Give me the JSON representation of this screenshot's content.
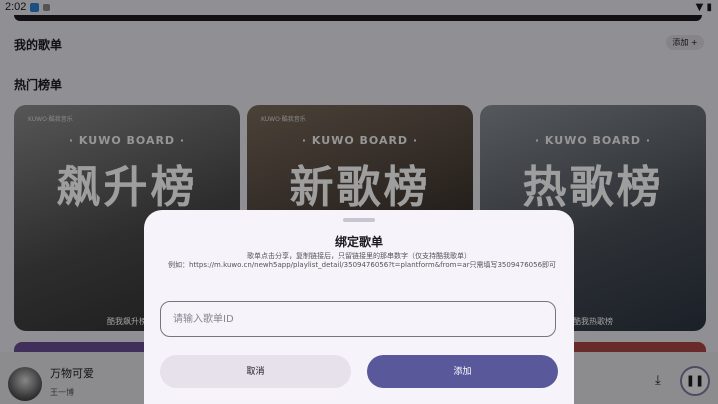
{
  "status_bar": {
    "time": "2:02",
    "icons": [
      "notification-icon",
      "media-icon",
      "wifi-icon",
      "battery-icon"
    ]
  },
  "sections": {
    "my_playlists": "我的歌单",
    "add_label": "添加 +",
    "hot_charts": "热门榜单"
  },
  "charts": [
    {
      "brand": "KUWO·酷我音乐",
      "board": "· KUWO BOARD ·",
      "title": "飙升榜",
      "caption": "酷我飙升榜"
    },
    {
      "brand": "KUWO·酷我音乐",
      "board": "· KUWO BOARD ·",
      "title": "新歌榜",
      "caption": ""
    },
    {
      "brand": "",
      "board": "· KUWO BOARD ·",
      "title": "热歌榜",
      "caption": "酷我热歌榜"
    }
  ],
  "player": {
    "title": "万物可爱",
    "artist": "王一博"
  },
  "dialog": {
    "title": "绑定歌单",
    "description": "歌单点击分享，复制链接后，只留链接里的那串数字（仅支持酷我歌单）",
    "example": "例如：https://m.kuwo.cn/newh5app/playlist_detail/3509476056?t=plantform&from=ar只需填写3509476056即可",
    "input_placeholder": "请输入歌单ID",
    "input_value": "",
    "cancel_label": "取消",
    "confirm_label": "添加"
  },
  "colors": {
    "accent": "#59589a",
    "sheet_bg": "#f6f3fb"
  }
}
